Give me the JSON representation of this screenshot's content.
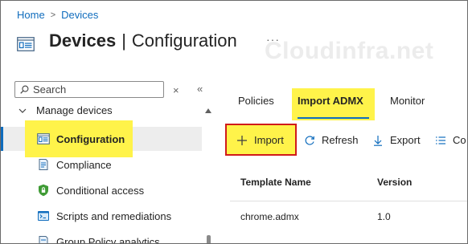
{
  "breadcrumb": {
    "home": "Home",
    "separator": ">",
    "current": "Devices"
  },
  "header": {
    "title_main": "Devices",
    "title_sep": "|",
    "title_sub": "Configuration",
    "more": "···"
  },
  "watermark": "Cloudinfra.net",
  "sidebar": {
    "search_placeholder": "Search",
    "clear_label": "×",
    "collapse_label": "«",
    "group": {
      "label": "Manage devices",
      "expanded": true
    },
    "items": [
      {
        "label": "Configuration",
        "icon": "configuration-icon",
        "active": true
      },
      {
        "label": "Compliance",
        "icon": "compliance-icon"
      },
      {
        "label": "Conditional access",
        "icon": "shield-icon"
      },
      {
        "label": "Scripts and remediations",
        "icon": "scripts-icon"
      },
      {
        "label": "Group Policy analytics",
        "icon": "group-policy-icon"
      }
    ]
  },
  "tabs": [
    {
      "label": "Policies"
    },
    {
      "label": "Import ADMX",
      "selected": true
    },
    {
      "label": "Monitor"
    }
  ],
  "toolbar": [
    {
      "label": "Import",
      "icon": "plus-icon"
    },
    {
      "label": "Refresh",
      "icon": "refresh-icon"
    },
    {
      "label": "Export",
      "icon": "download-icon"
    },
    {
      "label": "Co",
      "icon": "columns-icon"
    }
  ],
  "table": {
    "columns": [
      "Template Name",
      "Version"
    ],
    "rows": [
      {
        "template_name": "chrome.admx",
        "version": "1.0"
      }
    ]
  },
  "colors": {
    "accent": "#0f6cbd",
    "highlight": "#fff34a",
    "annotation_border": "#d01b1b"
  }
}
